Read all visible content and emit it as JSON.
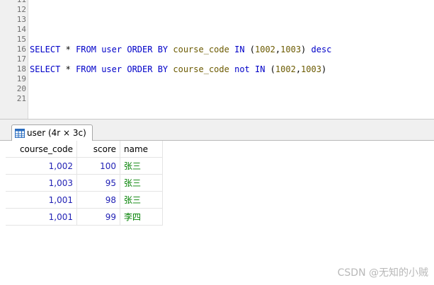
{
  "editor": {
    "lines": [
      {
        "n": "11",
        "tokens": []
      },
      {
        "n": "12",
        "tokens": []
      },
      {
        "n": "13",
        "tokens": []
      },
      {
        "n": "14",
        "tokens": []
      },
      {
        "n": "15",
        "tokens": []
      },
      {
        "n": "16",
        "tokens": [
          {
            "t": "SELECT",
            "c": "kw"
          },
          {
            "t": " ",
            "c": "op"
          },
          {
            "t": "*",
            "c": "op"
          },
          {
            "t": " ",
            "c": "op"
          },
          {
            "t": "FROM",
            "c": "kw"
          },
          {
            "t": " ",
            "c": "op"
          },
          {
            "t": "user",
            "c": "plain"
          },
          {
            "t": " ",
            "c": "op"
          },
          {
            "t": "ORDER BY",
            "c": "kw"
          },
          {
            "t": " ",
            "c": "op"
          },
          {
            "t": "course_code",
            "c": "fn"
          },
          {
            "t": " ",
            "c": "op"
          },
          {
            "t": "IN",
            "c": "kw"
          },
          {
            "t": " (",
            "c": "punc"
          },
          {
            "t": "1002",
            "c": "num"
          },
          {
            "t": ",",
            "c": "punc"
          },
          {
            "t": "1003",
            "c": "num"
          },
          {
            "t": ") ",
            "c": "punc"
          },
          {
            "t": "desc",
            "c": "kw"
          }
        ]
      },
      {
        "n": "17",
        "tokens": []
      },
      {
        "n": "18",
        "tokens": [
          {
            "t": "SELECT",
            "c": "kw"
          },
          {
            "t": " ",
            "c": "op"
          },
          {
            "t": "*",
            "c": "op"
          },
          {
            "t": " ",
            "c": "op"
          },
          {
            "t": "FROM",
            "c": "kw"
          },
          {
            "t": " ",
            "c": "op"
          },
          {
            "t": "user",
            "c": "plain"
          },
          {
            "t": " ",
            "c": "op"
          },
          {
            "t": "ORDER BY",
            "c": "kw"
          },
          {
            "t": " ",
            "c": "op"
          },
          {
            "t": "course_code",
            "c": "fn"
          },
          {
            "t": " ",
            "c": "op"
          },
          {
            "t": "not IN",
            "c": "kw"
          },
          {
            "t": " (",
            "c": "punc"
          },
          {
            "t": "1002",
            "c": "num"
          },
          {
            "t": ",",
            "c": "punc"
          },
          {
            "t": "1003",
            "c": "num"
          },
          {
            "t": ")",
            "c": "punc"
          }
        ]
      },
      {
        "n": "19",
        "tokens": []
      },
      {
        "n": "20",
        "tokens": []
      },
      {
        "n": "21",
        "tokens": []
      }
    ]
  },
  "result_tab": {
    "label": "user (4r × 3c)",
    "icon": "table-icon"
  },
  "grid": {
    "columns": [
      "course_code",
      "score",
      "name"
    ],
    "rows": [
      [
        "1,002",
        "100",
        "张三"
      ],
      [
        "1,003",
        "95",
        "张三"
      ],
      [
        "1,001",
        "98",
        "张三"
      ],
      [
        "1,001",
        "99",
        "李四"
      ]
    ]
  },
  "watermark": "CSDN @无知的小贼",
  "colors": {
    "keyword": "#0000c8",
    "identifier": "#6b5a00",
    "cell_number": "#1f1fb4",
    "cell_text": "#008000"
  }
}
